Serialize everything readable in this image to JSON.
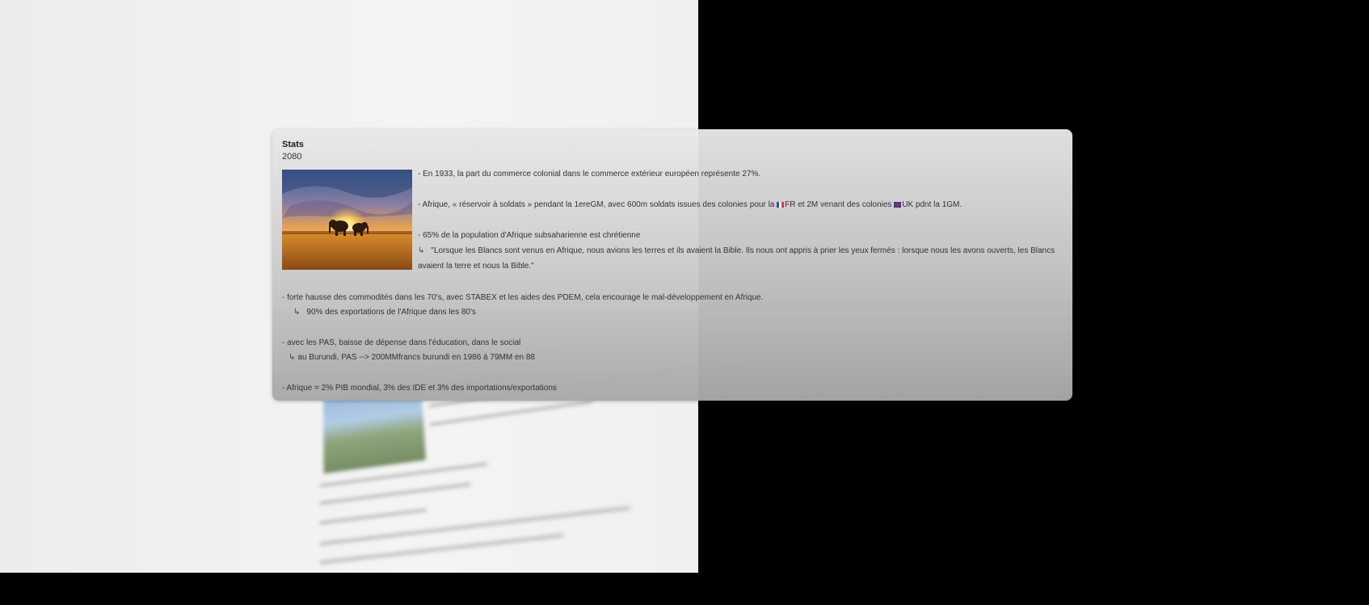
{
  "card": {
    "title": "Stats",
    "subtitle": "2080",
    "image_icon": "elephant-sunset-photo",
    "lines": {
      "l1": "- En 1933, la part du commerce colonial dans le commerce extérieur européen représente 27%.",
      "l2a": "- Afrique, « réservoir à soldats » pendant la 1ereGM, avec 600m soldats issues des colonies pour la ",
      "l2b": "FR et 2M venant des colonies ",
      "l2c": "UK pdnt la 1GM.",
      "l3": "- 65% de la population d'Afrique subsaharienne est chrétienne",
      "l4": "\"Lorsque les Blancs sont venus en Afrique, nous avions les terres et ils avaient la Bible. Ils nous ont appris à prier les yeux fermés : lorsque nous les avons ouverts, les Blancs",
      "l4b": "avaient la terre et nous la Bible.\"",
      "l5": "- forte hausse des commodités dans les 70's, avec STABEX et les aides des PDEM, cela encourage le mal-développement en Afrique.",
      "l6": "90% des exportations de l'Afrique dans les 80's",
      "l7": "- avec les PAS, baisse de dépense dans l'éducation, dans le social",
      "l8": "au Burundi, PAS --> 200MMfrancs burundi en 1986 à 79MM en 88",
      "l9": "- Afrique = 2% PIB mondial, 3% des IDE et 3% des importations/exportations"
    },
    "arrow_glyph": "↳"
  },
  "colors": {
    "left_background": "#f0f0f0",
    "right_background": "#000000",
    "text": "#333333"
  }
}
